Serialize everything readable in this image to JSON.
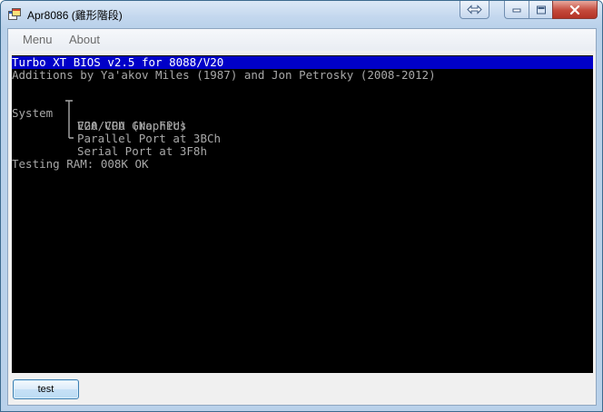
{
  "window": {
    "title": "Apr8086 (雞形階段)",
    "icon": "app-window-icon"
  },
  "menubar": {
    "items": [
      {
        "label": "Menu"
      },
      {
        "label": "About"
      }
    ]
  },
  "screen": {
    "lines": [
      "Turbo XT BIOS v2.5 for 8088/V20",
      "Additions by Ya'akov Miles (1987) and Jon Petrosky (2008-2012)"
    ],
    "system_label": "System",
    "system_items": [
      "V20 CPU (No FPU)",
      "EGA/VGA Graphics",
      "Parallel Port at 3BCh",
      "Serial Port at 3F8h"
    ],
    "ram_test": "Testing RAM: 008K OK"
  },
  "footer": {
    "test_button": "test"
  },
  "colors": {
    "highlight_bg": "#0000c8",
    "screen_bg": "#000000",
    "screen_text": "#a8a8a8"
  }
}
